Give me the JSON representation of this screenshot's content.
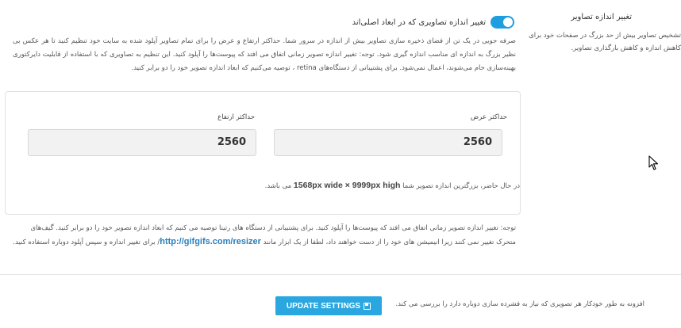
{
  "side": {
    "title": "تغییر اندازه تصاویر",
    "description": "تشخیص تصاویر بیش از حد بزرگ در صفحات خود برای کاهش اندازه و کاهش بارگذاری تصاویر."
  },
  "toggle": {
    "label": "تغییر اندازه تصاویری که در ابعاد اصلی‌اند",
    "state": "on"
  },
  "main_description": "صرفه جویی در یک تن از فضای ذخیره سازی تصاویر بیش از اندازه در سرور شما. حداکثر ارتفاع و عرض را برای تمام تصاویر آپلود شده به سایت خود تنظیم کنید تا هر عکس بی نظیر بزرگ به اندازه ای مناسب اندازه گیری شود. توجه: تغییر اندازه تصویر زمانی اتفاق می افتد که پیوست‌ها را آپلود کنید. این تنظیم به تصاویری که با استفاده از قابلیت دایرکتوری بهینه‌سازی خام می‌شوند، اعمال نمی‌شود. برای پشتیبانی از دستگاه‌های retina ، توصیه می‌کنیم که ابعاد اندازه تصویر خود را دو برابر کنید.",
  "dimensions": {
    "width_label": "حداکثر عرض",
    "width_value": "2560",
    "height_label": "حداکثر ارتفاع",
    "height_value": "2560",
    "current_prefix": "در حال حاضر، بزرگترین اندازه تصویر شما",
    "current_size": "1568px wide × 9999px high",
    "current_suffix": "می باشد."
  },
  "note": {
    "text_before": "توجه: تغییر اندازه تصویر زمانی اتفاق می افتد که پیوست‌ها را آپلود کنید. برای پشتیبانی از دستگاه های رتینا توصیه می کنیم که ابعاد اندازه تصویر خود را دو برابر کنید. گیف‌های متحرک تغییر نمی کنند زیرا انیمیشن های خود را از دست خواهند داد، لطفا از یک ابزار مانند",
    "link": "http://gifgifs.com/resizer",
    "text_after": "/ برای تغییر اندازه و سپس آپلود دوباره استفاده کنید."
  },
  "footer": {
    "note": "افزونه به طور خودکار هر تصویری که نیاز به فشرده سازی دوباره دارد را بررسی می کند.",
    "button_label": "UPDATE SETTINGS",
    "button_icon": "save-icon"
  },
  "colors": {
    "accent": "#2aa7e0",
    "toggle": "#1e9ee0",
    "link": "#2a7fbd"
  }
}
